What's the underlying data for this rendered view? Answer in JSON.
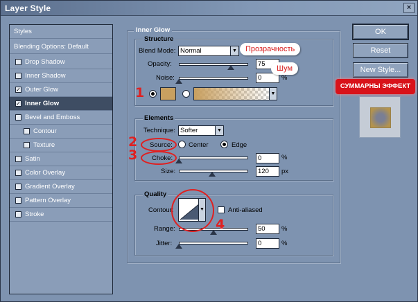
{
  "window": {
    "title": "Layer Style",
    "close_glyph": "×"
  },
  "sidebar": {
    "header": "Styles",
    "blending": "Blending Options: Default",
    "items": [
      {
        "label": "Drop Shadow",
        "checked": false
      },
      {
        "label": "Inner Shadow",
        "checked": false
      },
      {
        "label": "Outer Glow",
        "checked": true
      },
      {
        "label": "Inner Glow",
        "checked": true,
        "selected": true
      },
      {
        "label": "Bevel and Emboss",
        "checked": false
      },
      {
        "label": "Contour",
        "checked": false,
        "indent": true
      },
      {
        "label": "Texture",
        "checked": false,
        "indent": true
      },
      {
        "label": "Satin",
        "checked": false
      },
      {
        "label": "Color Overlay",
        "checked": false
      },
      {
        "label": "Gradient Overlay",
        "checked": false
      },
      {
        "label": "Pattern Overlay",
        "checked": false
      },
      {
        "label": "Stroke",
        "checked": false
      }
    ]
  },
  "panel": {
    "title": "Inner Glow",
    "structure": {
      "title": "Structure",
      "blend_mode_label": "Blend Mode:",
      "blend_mode_value": "Normal",
      "opacity_label": "Opacity:",
      "opacity_value": "75",
      "opacity_level": 0.75,
      "noise_label": "Noise:",
      "noise_value": "0",
      "noise_level": 0,
      "unit": "%",
      "glow_color": "#c8a060"
    },
    "elements": {
      "title": "Elements",
      "technique_label": "Technique:",
      "technique_value": "Softer",
      "source_label": "Source:",
      "center_label": "Center",
      "edge_label": "Edge",
      "source_selected": "edge",
      "choke_label": "Choke:",
      "choke_value": "0",
      "choke_level": 0,
      "size_label": "Size:",
      "size_value": "120",
      "size_level": 0.48,
      "unit_pct": "%",
      "unit_px": "px"
    },
    "quality": {
      "title": "Quality",
      "contour_label": "Contour:",
      "anti_aliased_label": "Anti-aliased",
      "range_label": "Range:",
      "range_value": "50",
      "range_level": 0.5,
      "jitter_label": "Jitter:",
      "jitter_value": "0",
      "jitter_level": 0,
      "unit": "%"
    }
  },
  "buttons": {
    "ok": "OK",
    "reset": "Reset",
    "new_style": "New Style...",
    "preview_checked": true
  },
  "annotations": {
    "opacity_callout": "Прозрачность",
    "noise_callout": "Шум",
    "effect_badge": "СУММАРНЫ ЭФФЕКТ",
    "num1": "1",
    "num2": "2",
    "num3": "3",
    "num4": "4"
  }
}
